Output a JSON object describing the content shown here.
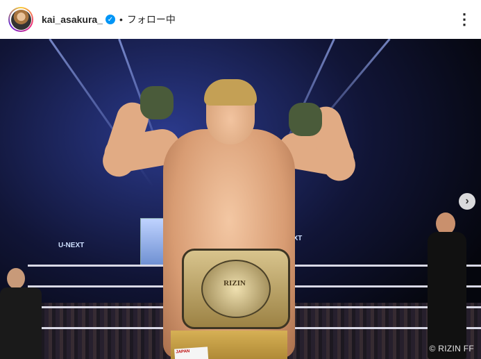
{
  "header": {
    "username": "kai_asakura_",
    "verified_icon": "verified-badge-icon",
    "separator": "•",
    "follow_status": "フォロー中",
    "more_icon": "more-options-icon",
    "more_glyph": "⋮"
  },
  "photo": {
    "belt_text": "RIZIN",
    "screen_brand_left": "U-NEXT",
    "screen_brand_right": "U-NEXT",
    "credit": "© RIZIN FF",
    "next_icon": "chevron-right-icon",
    "next_glyph": "›",
    "trunks_tag": "JAPAN"
  },
  "colors": {
    "verified_blue": "#0095f6",
    "text_dark": "#262626"
  }
}
